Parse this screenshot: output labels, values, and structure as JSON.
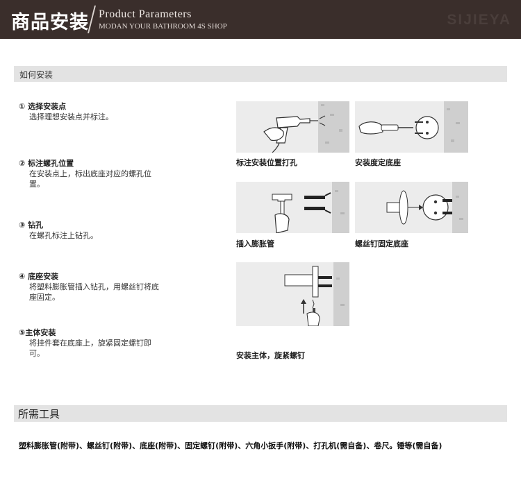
{
  "banner": {
    "title_cn": "商品安装",
    "title_en": "Product Parameters",
    "subtitle_en": "MODAN YOUR BATHROOM 4S SHOP",
    "brand": "SIJIEYA"
  },
  "install_section": {
    "heading": "如何安装",
    "steps": [
      {
        "title": "① 选择安装点",
        "desc": "选择理想安装点并标注。"
      },
      {
        "title": "② 标注螺孔位置",
        "desc": "在安装点上，标出底座对应的螺孔位置。"
      },
      {
        "title": "③ 钻孔",
        "desc": "在螺孔标注上钻孔。"
      },
      {
        "title": "④ 底座安装",
        "desc": "将塑料膨胀管插入钻孔，用螺丝钉将底座固定。"
      },
      {
        "title": "⑤主体安装",
        "desc": "将挂件套在底座上，旋紧固定螺钉即可。"
      }
    ],
    "images": [
      {
        "caption": "标注安装位置打孔",
        "icon": "drill-icon"
      },
      {
        "caption": "安装度定底座",
        "icon": "screwdriver-icon"
      },
      {
        "caption": "插入膨胀管",
        "icon": "hammer-icon"
      },
      {
        "caption": "螺丝钉固定底座",
        "icon": "base-plate-icon"
      },
      {
        "caption": "安装主体，旋紧螺钉",
        "icon": "hex-wrench-icon"
      }
    ]
  },
  "tools_section": {
    "heading": "所需工具",
    "text": "塑料膨胀管(附带)、螺丝钉(附带)、底座(附带)、固定螺钉(附带)、六角小扳手(附带)、打孔机(需自备)、卷尺。锤等(需自备)"
  }
}
